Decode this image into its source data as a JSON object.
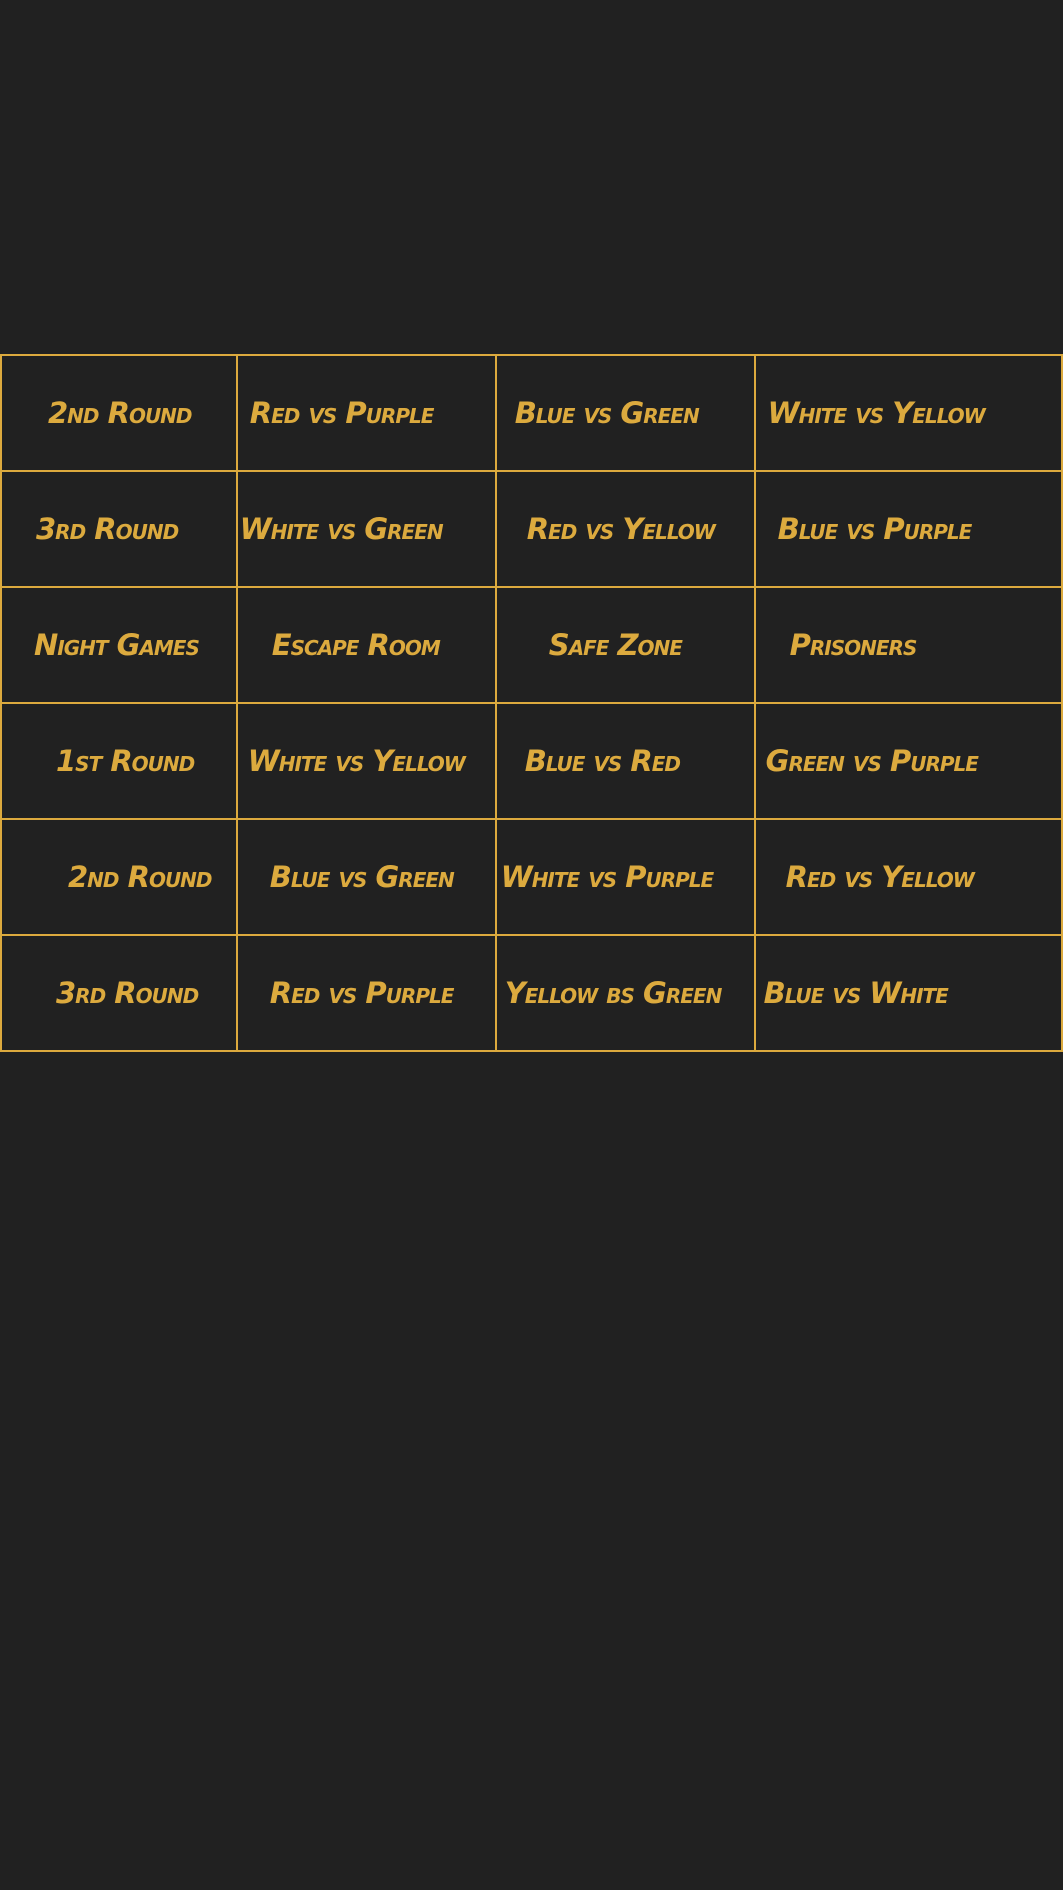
{
  "colors": {
    "background": "#212121",
    "accent": "#dcaa3e"
  },
  "rows": [
    {
      "cells": [
        "2nd Round",
        "Red vs Purple",
        "Blue vs Green",
        "White vs Yellow"
      ]
    },
    {
      "cells": [
        "3rd Round",
        "White vs Green",
        "Red vs Yellow",
        "Blue vs Purple"
      ]
    },
    {
      "cells": [
        "Night Games",
        "Escape Room",
        "Safe Zone",
        "Prisoners"
      ]
    },
    {
      "cells": [
        "1st Round",
        "White vs Yellow",
        "Blue vs Red",
        "Green vs Purple"
      ]
    },
    {
      "cells": [
        "2nd Round",
        "Blue vs Green",
        "White vs Purple",
        "Red vs Yellow"
      ]
    },
    {
      "cells": [
        "3rd Round",
        "Red vs Purple",
        "Yellow bs Green",
        "Blue vs White"
      ]
    }
  ]
}
